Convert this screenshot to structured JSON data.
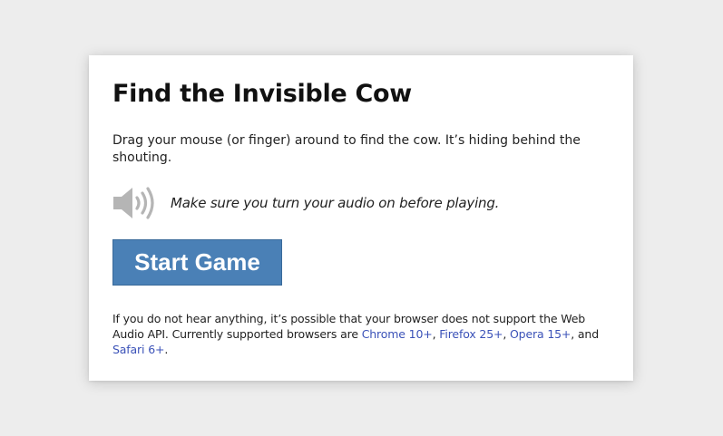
{
  "card": {
    "title": "Find the Invisible Cow",
    "intro": "Drag your mouse (or finger) around to find the cow. It’s hiding behind the shouting.",
    "audio_note": "Make sure you turn your audio on before playing.",
    "audio_icon": "speaker-volume-icon",
    "start_button_label": "Start Game",
    "footer": {
      "text_before": "If you do not hear anything, it’s possible that your browser does not support the Web Audio API. Currently supported browsers are ",
      "links": [
        {
          "label": "Chrome 10+"
        },
        {
          "label": "Firefox 25+"
        },
        {
          "label": "Opera 15+"
        },
        {
          "label": "Safari 6+"
        }
      ],
      "sep_comma": ", ",
      "sep_and": ", and ",
      "text_after": "."
    }
  },
  "colors": {
    "page_background": "#ededed",
    "card_background": "#ffffff",
    "button_background": "#4a80b6",
    "button_text": "#ffffff",
    "link": "#3b52b8",
    "icon": "#b5b5b5"
  }
}
